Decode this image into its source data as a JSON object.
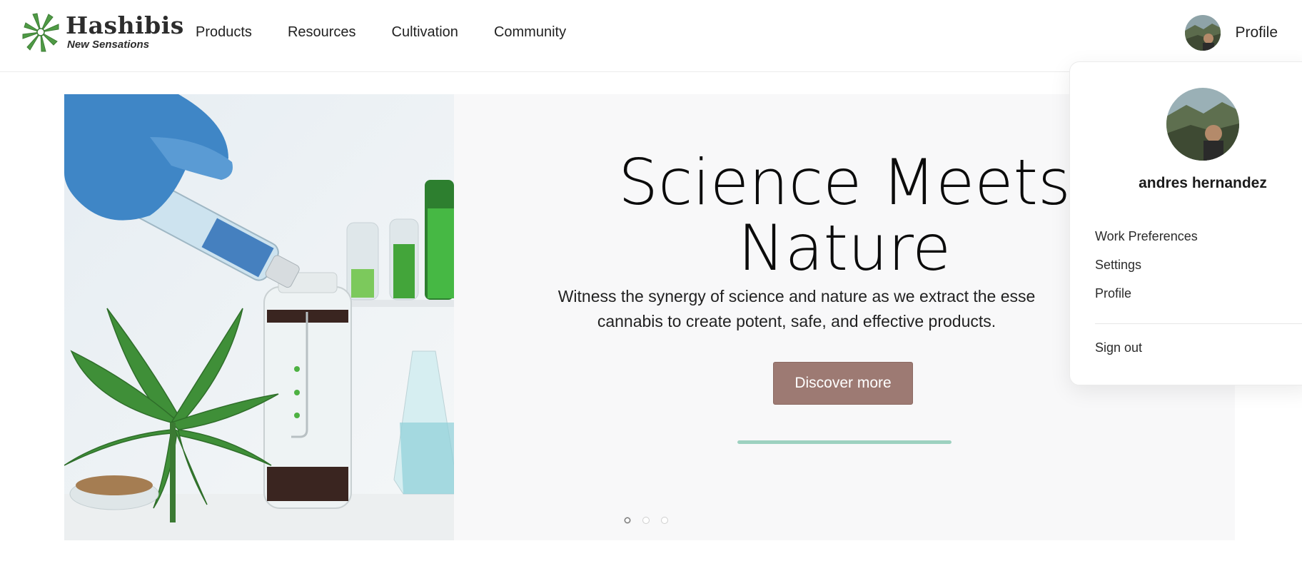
{
  "brand": {
    "name": "Hashibis",
    "tagline": "New Sensations"
  },
  "nav": {
    "items": [
      {
        "label": "Products"
      },
      {
        "label": "Resources"
      },
      {
        "label": "Cultivation"
      },
      {
        "label": "Community"
      }
    ]
  },
  "profile": {
    "label": "Profile"
  },
  "hero": {
    "title_line1": "Science Meets",
    "title_line2": "Nature",
    "text_line1": "Witness the synergy of science and nature as we extract the esse",
    "text_line2": "cannabis to create potent, safe, and effective products.",
    "button_label": "Discover more",
    "progress_fraction": 1.0,
    "slides_count": 3,
    "active_slide": 1
  },
  "dropdown": {
    "user_name": "andres hernandez",
    "items": [
      {
        "label": "Work Preferences"
      },
      {
        "label": "Settings"
      },
      {
        "label": "Profile"
      }
    ],
    "sign_out": "Sign out"
  },
  "colors": {
    "accent_button": "#9d7a73",
    "progress": "#9dd1c0",
    "leaf_green": "#4a9a3b"
  },
  "icons": {
    "logo": "hashibis-leaf-logo",
    "avatar": "user-avatar-photo"
  }
}
